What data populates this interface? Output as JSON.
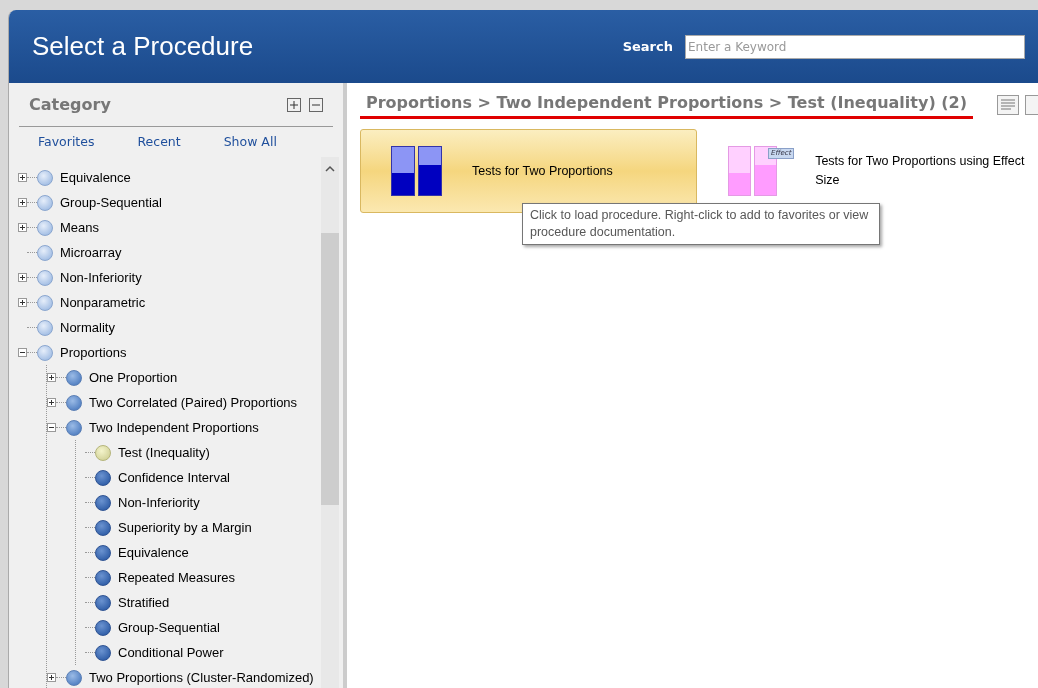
{
  "header": {
    "title": "Select a Procedure",
    "search_label": "Search",
    "search_placeholder": "Enter a Keyword"
  },
  "category": {
    "title": "Category",
    "tabs": [
      {
        "label": "Favorites"
      },
      {
        "label": "Recent"
      },
      {
        "label": "Show All"
      }
    ],
    "tree": [
      {
        "label": "Equivalence",
        "expanded": false,
        "selected": false
      },
      {
        "label": "Group-Sequential",
        "expanded": false,
        "selected": false
      },
      {
        "label": "Means",
        "expanded": false,
        "selected": false
      },
      {
        "label": "Microarray",
        "selected": false
      },
      {
        "label": "Non-Inferiority",
        "expanded": false,
        "selected": false
      },
      {
        "label": "Nonparametric",
        "expanded": false,
        "selected": false
      },
      {
        "label": "Normality",
        "selected": false
      },
      {
        "label": "Proportions",
        "expanded": true,
        "selected": false,
        "children": [
          {
            "label": "One Proportion",
            "expanded": false,
            "selected": false
          },
          {
            "label": "Two Correlated (Paired) Proportions",
            "expanded": false,
            "selected": false
          },
          {
            "label": "Two Independent Proportions",
            "expanded": true,
            "selected": false,
            "children": [
              {
                "label": "Test (Inequality)",
                "selected": true
              },
              {
                "label": "Confidence Interval",
                "selected": false
              },
              {
                "label": "Non-Inferiority",
                "selected": false
              },
              {
                "label": "Superiority by a Margin",
                "selected": false
              },
              {
                "label": "Equivalence",
                "selected": false
              },
              {
                "label": "Repeated Measures",
                "selected": false
              },
              {
                "label": "Stratified",
                "selected": false
              },
              {
                "label": "Group-Sequential",
                "selected": false
              },
              {
                "label": "Conditional Power",
                "selected": false
              }
            ]
          },
          {
            "label": "Two Proportions (Cluster-Randomized)",
            "expanded": false,
            "selected": false
          }
        ]
      }
    ]
  },
  "content": {
    "breadcrumb": "Proportions > Two Independent Proportions > Test (Inequality) (2)",
    "procedures": [
      {
        "label": "Tests for Two Proportions",
        "selected": true,
        "kind": "plain"
      },
      {
        "label": "Tests for Two Proportions using Effect Size",
        "selected": false,
        "kind": "effect",
        "badge": "Effect"
      }
    ],
    "tooltip": "Click to load procedure. Right-click to add to favorites or view procedure documentation."
  }
}
